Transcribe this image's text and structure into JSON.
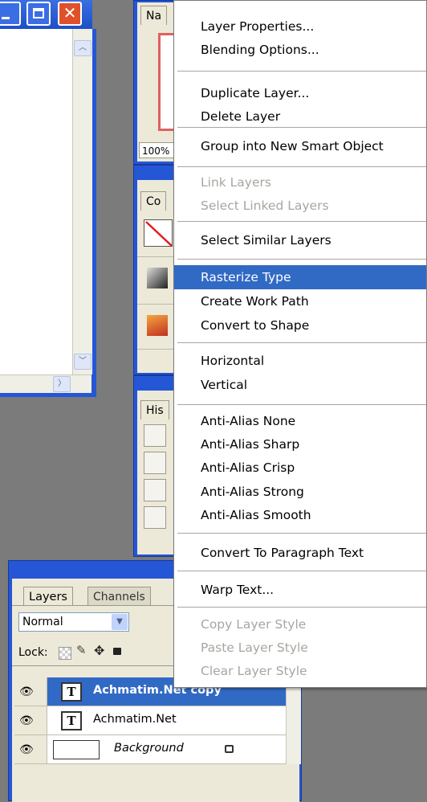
{
  "left_window": {
    "scroll_up_arrow": "︿",
    "scroll_down_arrow": "﹀",
    "scroll_right_arrow": "〉"
  },
  "navigator_panel": {
    "tab_label": "Na",
    "zoom_value": "100%"
  },
  "color_panel": {
    "tab_label": "Co"
  },
  "history_panel": {
    "tab_label": "His"
  },
  "context_menu": {
    "items": [
      {
        "label": "Layer Properties...",
        "enabled": true
      },
      {
        "label": "Blending Options...",
        "enabled": true
      },
      {
        "label": "Duplicate Layer...",
        "enabled": true
      },
      {
        "label": "Delete Layer",
        "enabled": true
      },
      {
        "label": "Group into New Smart Object",
        "enabled": true
      },
      {
        "label": "Link Layers",
        "enabled": false
      },
      {
        "label": "Select Linked Layers",
        "enabled": false
      },
      {
        "label": "Select Similar Layers",
        "enabled": true
      },
      {
        "label": "Rasterize Type",
        "enabled": true,
        "highlighted": true
      },
      {
        "label": "Create Work Path",
        "enabled": true
      },
      {
        "label": "Convert to Shape",
        "enabled": true
      },
      {
        "label": "Horizontal",
        "enabled": true
      },
      {
        "label": "Vertical",
        "enabled": true
      },
      {
        "label": "Anti-Alias None",
        "enabled": true
      },
      {
        "label": "Anti-Alias Sharp",
        "enabled": true
      },
      {
        "label": "Anti-Alias Crisp",
        "enabled": true
      },
      {
        "label": "Anti-Alias Strong",
        "enabled": true
      },
      {
        "label": "Anti-Alias Smooth",
        "enabled": true
      },
      {
        "label": "Convert To Paragraph Text",
        "enabled": true
      },
      {
        "label": "Warp Text...",
        "enabled": true
      },
      {
        "label": "Copy Layer Style",
        "enabled": false
      },
      {
        "label": "Paste Layer Style",
        "enabled": false
      },
      {
        "label": "Clear Layer Style",
        "enabled": false
      }
    ],
    "highlight_color": "#316ac5"
  },
  "layers_panel": {
    "tabs": [
      "Layers",
      "Channels"
    ],
    "blend_mode": "Normal",
    "lock_label": "Lock:",
    "layers": [
      {
        "name": "Achmatim.Net copy",
        "thumb": "T",
        "selected": true
      },
      {
        "name": "Achmatim.Net",
        "thumb": "T",
        "selected": false
      },
      {
        "name": "Background",
        "thumb": "",
        "selected": false,
        "locked": true
      }
    ]
  },
  "colors": {
    "title_blue": "#2456d6",
    "panel_bg": "#ece9d8",
    "close_red": "#e0502a"
  }
}
